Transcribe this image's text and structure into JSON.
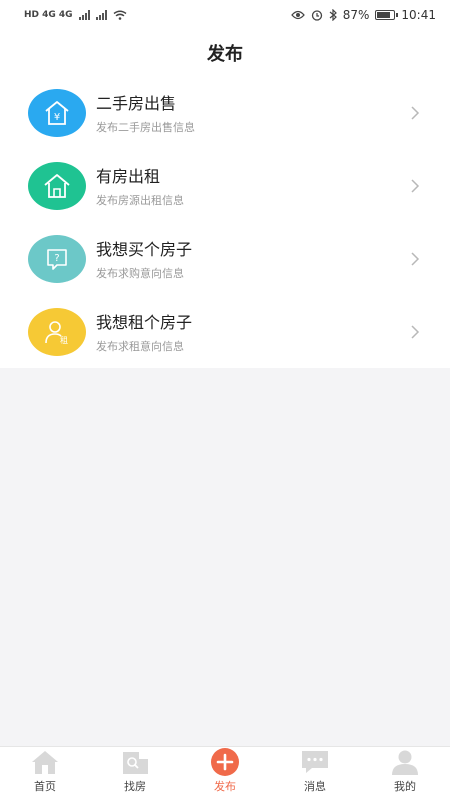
{
  "status_bar": {
    "left_text": "HD 4G 4G",
    "battery": "87%",
    "time": "10:41"
  },
  "header": {
    "title": "发布"
  },
  "items": [
    {
      "title": "二手房出售",
      "subtitle": "发布二手房出售信息",
      "icon": "house-yuan-icon",
      "color": "#2aa9f0"
    },
    {
      "title": "有房出租",
      "subtitle": "发布房源出租信息",
      "icon": "house-icon",
      "color": "#1fc392"
    },
    {
      "title": "我想买个房子",
      "subtitle": "发布求购意向信息",
      "icon": "question-chat-icon",
      "color": "#6cc8c8"
    },
    {
      "title": "我想租个房子",
      "subtitle": "发布求租意向信息",
      "icon": "person-rent-icon",
      "color": "#f6c935"
    }
  ],
  "tabs": [
    {
      "label": "首页",
      "icon": "home-icon",
      "active": false
    },
    {
      "label": "找房",
      "icon": "search-house-icon",
      "active": false
    },
    {
      "label": "发布",
      "icon": "plus-circle-icon",
      "active": true
    },
    {
      "label": "消息",
      "icon": "message-icon",
      "active": false
    },
    {
      "label": "我的",
      "icon": "user-icon",
      "active": false
    }
  ],
  "colors": {
    "accent": "#f06a4a",
    "tab_icon": "#d8d8d8"
  }
}
